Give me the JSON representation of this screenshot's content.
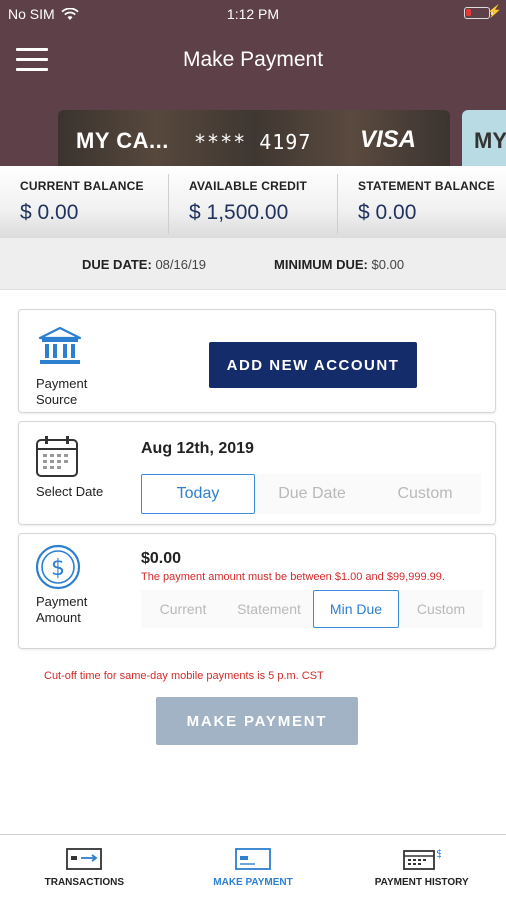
{
  "status": {
    "carrier": "No SIM",
    "time": "1:12 PM"
  },
  "header": {
    "title": "Make Payment"
  },
  "cards": [
    {
      "name": "MY CA...",
      "number": "**** 4197",
      "brand": "VISA"
    },
    {
      "name": "MY"
    }
  ],
  "balances": [
    {
      "label": "CURRENT BALANCE",
      "value": "$ 0.00"
    },
    {
      "label": "AVAILABLE CREDIT",
      "value": "$ 1,500.00"
    },
    {
      "label": "STATEMENT BALANCE",
      "value": "$ 0.00"
    }
  ],
  "due": {
    "date_label": "DUE DATE:",
    "date_value": "08/16/19",
    "min_label": "MINIMUM DUE:",
    "min_value": "$0.00"
  },
  "source": {
    "label_line1": "Payment",
    "label_line2": "Source",
    "add_button": "ADD NEW ACCOUNT",
    "icon": "bank-icon"
  },
  "date_section": {
    "label": "Select Date",
    "value": "Aug 12th, 2019",
    "options": [
      "Today",
      "Due Date",
      "Custom"
    ],
    "selected": "Today",
    "icon": "calendar-icon"
  },
  "amount_section": {
    "label_line1": "Payment",
    "label_line2": "Amount",
    "value": "$0.00",
    "error": "The payment amount must be between $1.00 and $99,999.99.",
    "options": [
      "Current",
      "Statement",
      "Min Due",
      "Custom"
    ],
    "selected": "Min Due",
    "icon": "dollar-icon"
  },
  "cutoff": "Cut-off time for same-day mobile payments is 5 p.m. CST",
  "make_payment_button": "MAKE PAYMENT",
  "tabs": [
    {
      "label": "TRANSACTIONS",
      "icon": "transactions-icon"
    },
    {
      "label": "MAKE PAYMENT",
      "icon": "make-payment-icon"
    },
    {
      "label": "PAYMENT HISTORY",
      "icon": "payment-history-icon"
    }
  ],
  "colors": {
    "header": "#5e4048",
    "navy": "#152c6a",
    "accent": "#2d7fcf",
    "error": "#d22b2b",
    "disabled": "#a3b3c6"
  }
}
